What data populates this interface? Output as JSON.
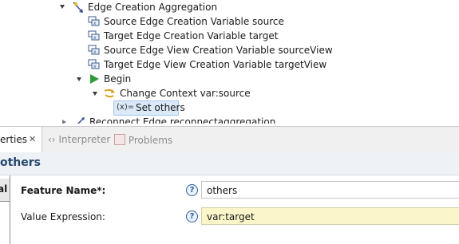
{
  "tree": {
    "root_label": "Edge Creation Aggregation",
    "variables": [
      "Source Edge Creation Variable source",
      "Target Edge Creation Variable target",
      "Source Edge View Creation Variable sourceView",
      "Target Edge View Creation Variable targetView"
    ],
    "begin_label": "Begin",
    "change_context_label": "Change Context var:source",
    "set_label": "Set others",
    "set_prefix": "(x)=",
    "next_label": "Reconnect Edge reconnectaggregation"
  },
  "tabs": {
    "properties_label": "erties",
    "interpreter_label": "Interpreter",
    "problems_label": "Problems"
  },
  "title": "others",
  "left_tab_label": "al",
  "form": {
    "feature_name_label": "Feature Name*:",
    "feature_name_value": "others",
    "value_expression_label": "Value Expression:",
    "value_expression_value": "var:target"
  },
  "colors": {
    "expression_bg": "#fbf6c9",
    "title_text": "#25496d",
    "selection_bg": "#dbe9f8",
    "begin_icon": "#2e9a3a"
  },
  "icons": {
    "root": "edge-creation-icon",
    "variable": "variable-icon",
    "begin": "begin-icon",
    "change_context": "change-context-icon",
    "set": "set-icon",
    "next": "reconnect-edge-icon",
    "interpreter": "interpreter-icon",
    "problems": "problems-icon",
    "help": "help-icon"
  }
}
